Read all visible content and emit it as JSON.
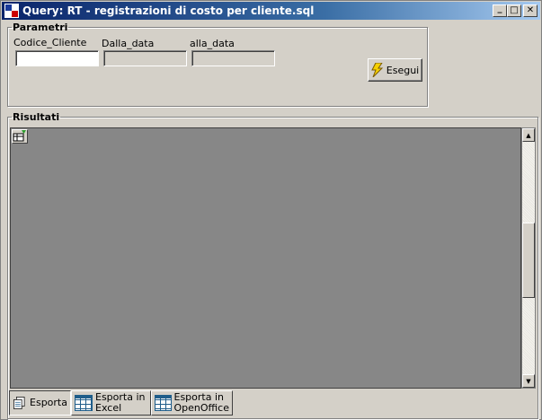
{
  "window": {
    "title": "Query: RT - registrazioni di costo per cliente.sql",
    "minimize_glyph": "_",
    "maximize_glyph": "□",
    "close_glyph": "✕"
  },
  "params": {
    "legend": "Parametri",
    "fields": [
      {
        "label": "Codice_Cliente",
        "value": ""
      },
      {
        "label": "Dalla_data",
        "value": ""
      },
      {
        "label": "alla_data",
        "value": ""
      }
    ],
    "run_label": "Esegui",
    "run_icon": "lightning-icon"
  },
  "results": {
    "legend": "Risultati",
    "grid_icon": "grid-filter-icon"
  },
  "toolbar": {
    "items": [
      {
        "label": "Esporta",
        "icon": "export-icon"
      },
      {
        "label": "Esporta in\nExcel",
        "icon": "spreadsheet-icon"
      },
      {
        "label": "Esporta in\nOpenOffice",
        "icon": "spreadsheet-icon"
      }
    ]
  }
}
